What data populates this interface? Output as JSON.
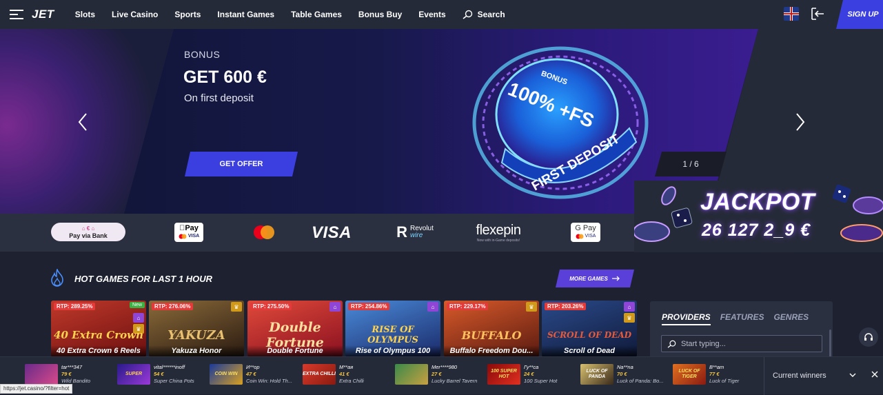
{
  "header": {
    "logo": "JET",
    "nav": [
      "Slots",
      "Live Casino",
      "Sports",
      "Instant Games",
      "Table Games",
      "Bonus Buy",
      "Events"
    ],
    "search_label": "Search",
    "signup_label": "SIGN UP",
    "language": "English (UK flag)"
  },
  "hero": {
    "bonus_label": "BONUS",
    "amount": "GET 600 €",
    "subtitle": "On first deposit",
    "cta": "GET OFFER",
    "pager": "1 / 6",
    "chip_top": "BONUS",
    "chip_main": "100% +FS",
    "chip_band": "FIRST DEPOSIT"
  },
  "payments": {
    "pay_via_bank": "Pay via Bank",
    "apple_pay": "Pay",
    "visa": "VISA",
    "revolut": "Revolut",
    "revolut_sub": "wire",
    "flexepin": "flexepin",
    "flexepin_sub": "Now with in-Game deposits!",
    "google_pay": "G Pay",
    "card_mini": "VISA"
  },
  "jackpot": {
    "title": "JACKPOT",
    "value": "26 127 2_9 €"
  },
  "hot_games": {
    "title": "HOT GAMES FOR LAST 1 HOUR",
    "more_label": "MORE GAMES",
    "games": [
      {
        "rtp": "RTP: 289.25%",
        "name": "40 Extra Crown 6 Reels",
        "art": "40 Extra Crown",
        "new": "New"
      },
      {
        "rtp": "RTP: 276.06%",
        "name": "Yakuza Honor",
        "art": "YAKUZA"
      },
      {
        "rtp": "RTP: 275.50%",
        "name": "Double Fortune",
        "art": "Double Fortune"
      },
      {
        "rtp": "RTP: 254.86%",
        "name": "Rise of Olympus 100",
        "art": "RISE OF OLYMPUS"
      },
      {
        "rtp": "RTP: 229.17%",
        "name": "Buffalo Freedom Dou...",
        "art": "BUFFALO"
      },
      {
        "rtp": "RTP: 203.26%",
        "name": "Scroll of Dead",
        "art": "SCROLL OF DEAD"
      }
    ]
  },
  "providers": {
    "tabs": [
      "PROVIDERS",
      "FEATURES",
      "GENRES"
    ],
    "search_placeholder": "Start typing..."
  },
  "winners": {
    "label": "Current winners",
    "items": [
      {
        "user": "tar***347",
        "amount": "79 €",
        "game": "Wild Bandito",
        "thumb": ""
      },
      {
        "user": "vital******inoff",
        "amount": "54 €",
        "game": "Super China Pots",
        "thumb": "SUPER"
      },
      {
        "user": "И**ор",
        "amount": "47 €",
        "game": "Coin Win: Hold Th...",
        "thumb": "COIN WIN"
      },
      {
        "user": "М**ая",
        "amount": "41 €",
        "game": "Extra Chilli",
        "thumb": "EXTRA CHILLI"
      },
      {
        "user": "Mer****980",
        "amount": "27 €",
        "game": "Lucky Barrel Tavern",
        "thumb": ""
      },
      {
        "user": "Гу**са",
        "amount": "24 €",
        "game": "100 Super Hot",
        "thumb": "100 SUPER HOT"
      },
      {
        "user": "Na**na",
        "amount": "70 €",
        "game": "Luck of Panda: Bo...",
        "thumb": "LUCK OF PANDA"
      },
      {
        "user": "В**ат",
        "amount": "77 €",
        "game": "Luck of Tiger",
        "thumb": "LUCK OF TIGER"
      }
    ]
  },
  "status_url": "https://jet.casino/?filter=hot",
  "colors": {
    "accent": "#3b3fe0",
    "more_games": "#5a3fd9",
    "rtp": "#e53a3a",
    "background": "#1e2230"
  }
}
